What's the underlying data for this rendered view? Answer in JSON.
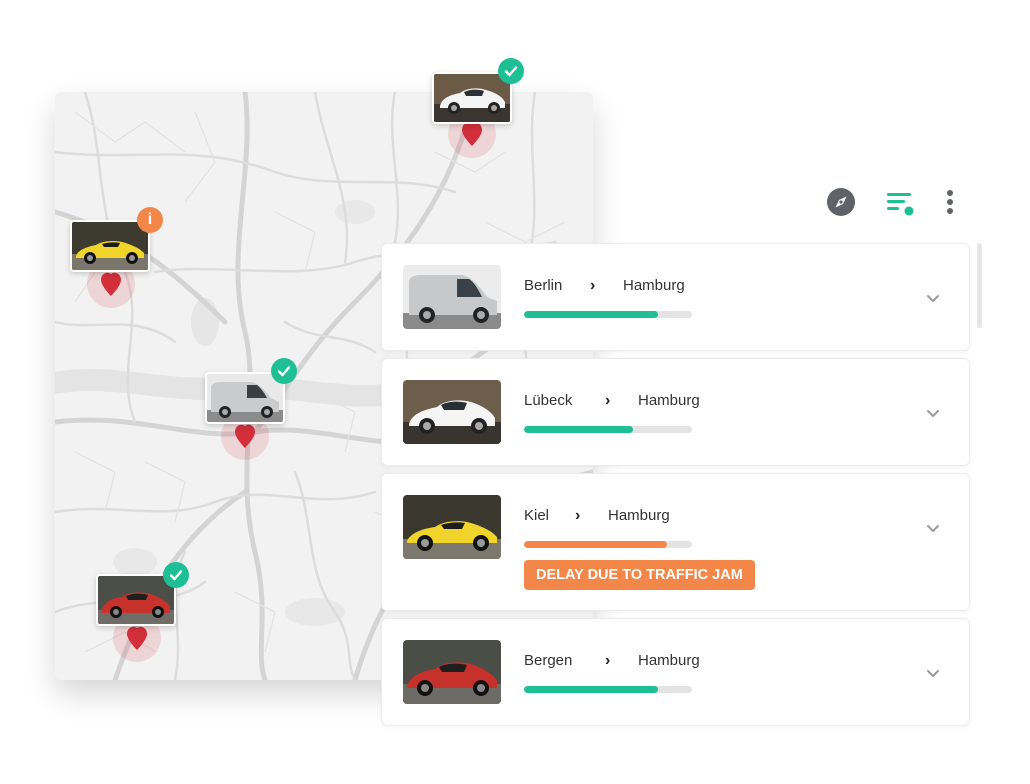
{
  "colors": {
    "accent": "#1fbf95",
    "warning": "#f3874a",
    "pin": "#d32f3a",
    "track": "#e3e3e3"
  },
  "toolbar": {
    "icons": [
      "compass-icon",
      "filter-icon",
      "more-vertical-icon"
    ]
  },
  "map": {
    "pins": [
      {
        "car": "white-sedan",
        "status": "ok"
      },
      {
        "car": "yellow-sports",
        "status": "warning"
      },
      {
        "car": "grey-van",
        "status": "ok"
      },
      {
        "car": "red-coupe",
        "status": "ok"
      }
    ]
  },
  "shipments": [
    {
      "from": "Berlin",
      "to": "Hamburg",
      "progress": 0.8,
      "status": "ok",
      "car": "grey-van"
    },
    {
      "from": "Lübeck",
      "to": "Hamburg",
      "progress": 0.65,
      "status": "ok",
      "car": "white-sedan"
    },
    {
      "from": "Kiel",
      "to": "Hamburg",
      "progress": 0.85,
      "status": "delayed",
      "alert": "DELAY DUE TO TRAFFIC JAM",
      "car": "yellow-sports"
    },
    {
      "from": "Bergen",
      "to": "Hamburg",
      "progress": 0.8,
      "status": "ok",
      "car": "red-coupe"
    }
  ]
}
